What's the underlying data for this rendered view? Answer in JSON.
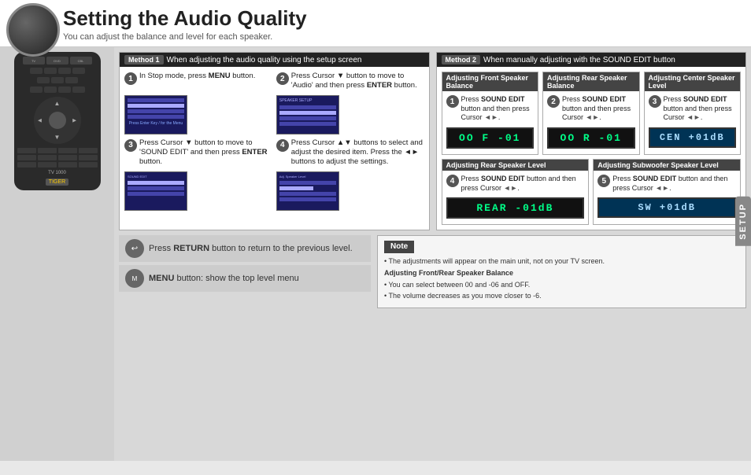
{
  "header": {
    "title": "Setting the Audio Quality",
    "subtitle": "You can adjust the balance and level for each speaker."
  },
  "method1": {
    "badge": "Method 1",
    "label": "When adjusting the audio quality using the setup screen",
    "steps": [
      {
        "num": "1",
        "text": "In Stop mode, press ",
        "bold": "MENU",
        "text2": " button."
      },
      {
        "num": "2",
        "text": "Press Cursor ▼ button to move to 'Audio' and then press ",
        "bold": "ENTER",
        "text2": " button."
      },
      {
        "num": "3",
        "text": "Press Cursor ▼ button to move to 'SOUND EDIT' and then press ",
        "bold": "ENTER",
        "text2": " button."
      },
      {
        "num": "4",
        "text": "Press Cursor ▲▼ buttons to select and adjust the desired item. Press the ◄► buttons to adjust the settings."
      }
    ]
  },
  "method2": {
    "badge": "Method 2",
    "label": "When manually adjusting with the SOUND EDIT button",
    "speakers": [
      {
        "title": "Adjusting Front Speaker Balance",
        "num": "1",
        "text": "Press SOUND EDIT button and then press Cursor ◄►.",
        "lcd": "OO F -01"
      },
      {
        "title": "Adjusting Rear Speaker Balance",
        "num": "2",
        "text": "Press SOUND EDIT button and then press Cursor ◄►.",
        "lcd": "OO R -01"
      },
      {
        "title": "Adjusting Center Speaker Level",
        "num": "3",
        "text": "Press SOUND EDIT button and then press Cursor ◄►.",
        "lcd": "CEN +01dB"
      },
      {
        "title": "Adjusting Rear Speaker Level",
        "num": "4",
        "text": "Press SOUND EDIT button and then press Cursor ◄►.",
        "lcd": "REAR -01dB"
      },
      {
        "title": "Adjusting Subwoofer Speaker Level",
        "num": "5",
        "text": "Press SOUND EDIT button and then press Cursor ◄►.",
        "lcd": "SW  +01dB"
      }
    ]
  },
  "note": {
    "header": "Note",
    "lines": [
      "• The adjustments will appear on the main unit, not on your TV screen.",
      "Adjusting Front/Rear Speaker Balance",
      "• You can select between 00 and -06 and OFF.",
      "• The volume decreases as you move closer to -6."
    ]
  },
  "bottom": {
    "return_text": "Press ",
    "return_bold": "RETURN",
    "return_text2": " button to return to the previous level.",
    "menu_text": "MENU button: show the top level menu"
  },
  "setup_tab": "SETUP"
}
